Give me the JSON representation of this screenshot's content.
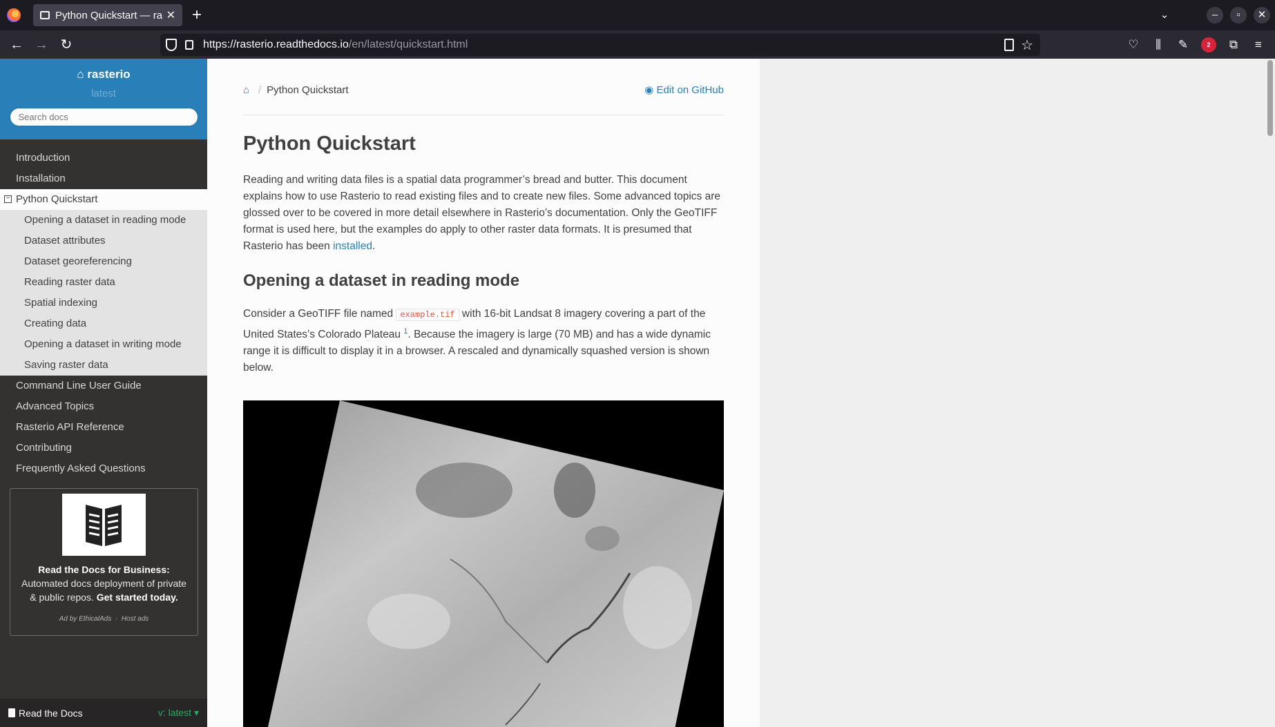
{
  "browser": {
    "tab_title": "Python Quickstart — rast",
    "url_host": "https://rasterio.readthedocs.io",
    "url_path": "/en/latest/quickstart.html",
    "abp_badge": "2"
  },
  "sidebar": {
    "project": "rasterio",
    "version": "latest",
    "search_placeholder": "Search docs",
    "items_top": [
      "Introduction",
      "Installation"
    ],
    "current": "Python Quickstart",
    "sub_items": [
      "Opening a dataset in reading mode",
      "Dataset attributes",
      "Dataset georeferencing",
      "Reading raster data",
      "Spatial indexing",
      "Creating data",
      "Opening a dataset in writing mode",
      "Saving raster data"
    ],
    "items_bottom": [
      "Command Line User Guide",
      "Advanced Topics",
      "Rasterio API Reference",
      "Contributing",
      "Frequently Asked Questions"
    ],
    "ad": {
      "bold": "Read the Docs for Business:",
      "text": " Automated docs deployment of private & public repos. ",
      "cta": "Get started today.",
      "by": "Ad by EthicalAds",
      "dot": "·",
      "host": "Host ads"
    },
    "footer": {
      "rtd": "Read the Docs",
      "version": "v: latest"
    }
  },
  "content": {
    "breadcrumb_current": "Python Quickstart",
    "breadcrumb_sep": "/",
    "edit_link": "Edit on GitHub",
    "h1": "Python Quickstart",
    "intro": "Reading and writing data files is a spatial data programmer’s bread and butter. This document explains how to use Rasterio to read existing files and to create new files. Some advanced topics are glossed over to be covered in more detail elsewhere in Rasterio’s documentation. Only the GeoTIFF format is used here, but the examples do apply to other raster data formats. It is presumed that Rasterio has been ",
    "intro_link": "installed",
    "intro_end": ".",
    "h2": "Opening a dataset in reading mode",
    "p2_a": "Consider a GeoTIFF file named ",
    "p2_code": "example.tif",
    "p2_b": " with 16-bit Landsat 8 imagery covering a part of the United States’s Colorado Plateau ",
    "p2_sup": "1",
    "p2_c": ". Because the imagery is large (70 MB) and has a wide dynamic range it is difficult to display it in a browser. A rescaled and dynamically squashed version is shown below."
  },
  "icons": {
    "back": "back-arrow-icon",
    "forward": "forward-arrow-icon",
    "reload": "reload-icon",
    "home": "home-icon",
    "github": "github-icon"
  }
}
